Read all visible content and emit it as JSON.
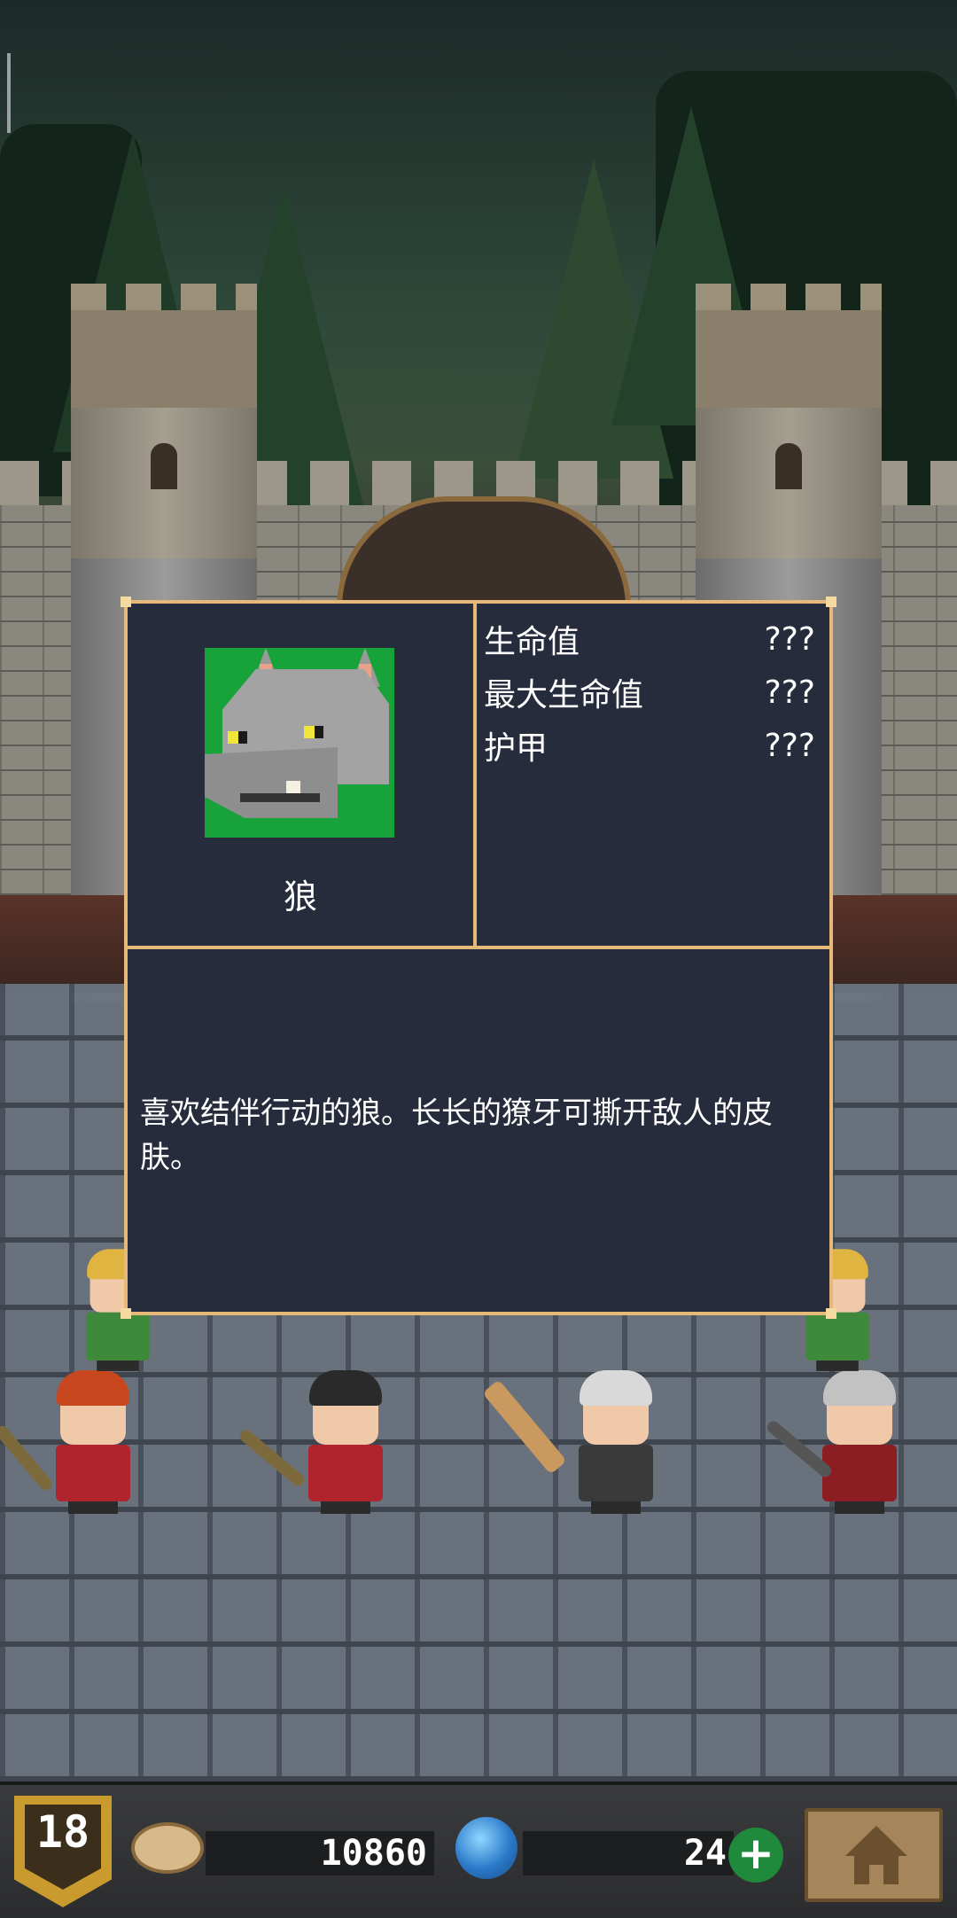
{
  "enemy": {
    "name": "狼",
    "portrait_icon": "wolf-portrait-icon",
    "stats": [
      {
        "label": "生命值",
        "value": "???"
      },
      {
        "label": "最大生命值",
        "value": "???"
      },
      {
        "label": "护甲",
        "value": "???"
      }
    ],
    "description": "喜欢结伴行动的狼。长长的獠牙可撕开敌人的皮肤。"
  },
  "bottom_bar": {
    "level": "18",
    "coins": "10860",
    "gems": "24",
    "plus_label": "+",
    "home_icon": "home-icon"
  },
  "colors": {
    "panel_bg": "#272c3c",
    "panel_border": "#e6b978",
    "portrait_bg": "#17a23a",
    "plus_button": "#1f8a3c"
  }
}
